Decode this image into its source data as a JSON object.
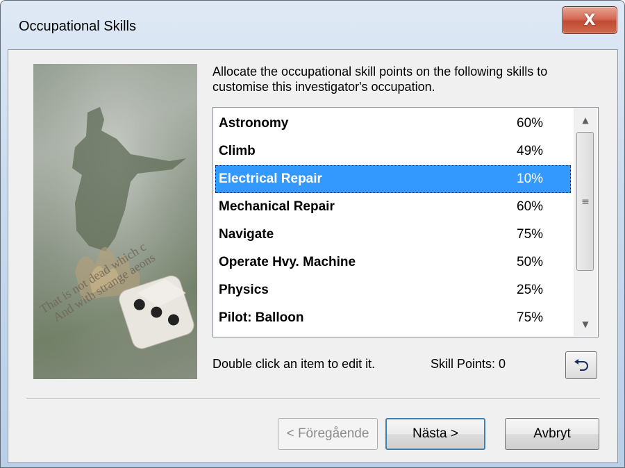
{
  "window": {
    "title": "Occupational Skills",
    "close_label": "X"
  },
  "intro_text": "Allocate the occupational skill points on the following skills to customise this investigator's occupation.",
  "skills": [
    {
      "name": "Astronomy",
      "value": "60%"
    },
    {
      "name": "Climb",
      "value": "49%"
    },
    {
      "name": "Electrical Repair",
      "value": "10%"
    },
    {
      "name": "Mechanical Repair",
      "value": "60%"
    },
    {
      "name": "Navigate",
      "value": "75%"
    },
    {
      "name": "Operate Hvy. Machine",
      "value": "50%"
    },
    {
      "name": "Physics",
      "value": "25%"
    },
    {
      "name": "Pilot: Balloon",
      "value": "75%"
    }
  ],
  "selected_skill": "Electrical Repair",
  "hint_text": "Double click an item to edit it.",
  "skill_points": "Skill Points:  0",
  "side_image_text": [
    "That is not dead which c",
    "And with strange aeons"
  ],
  "buttons": {
    "prev": "< Föregående",
    "next": "Nästa >",
    "cancel": "Avbryt"
  },
  "icons": {
    "close": "close-icon",
    "undo": "undo-icon",
    "scroll_up": "arrow-up-icon",
    "scroll_down": "arrow-down-icon"
  },
  "colors": {
    "selection": "#3399ff",
    "close_button": "#c24a34"
  }
}
